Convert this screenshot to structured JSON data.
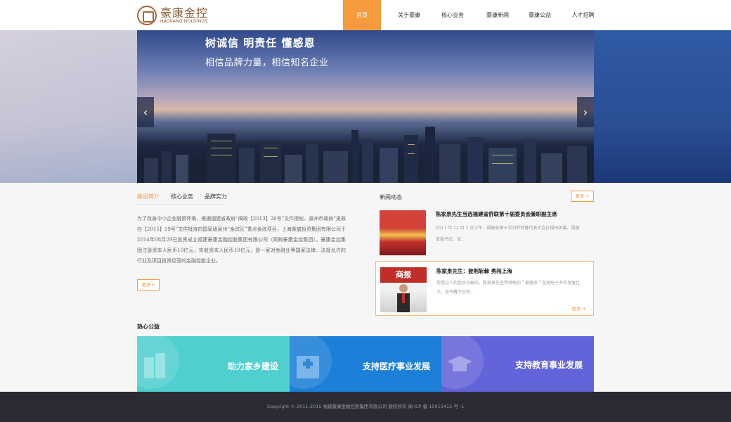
{
  "logo": {
    "cn": "豪康金控",
    "en": "HAOKANG HOLDINGS"
  },
  "nav": {
    "items": [
      {
        "label": "首页",
        "active": true
      },
      {
        "label": "关于豪康",
        "active": false
      },
      {
        "label": "核心业务",
        "active": false
      },
      {
        "label": "豪康新闻",
        "active": false
      },
      {
        "label": "豪康公益",
        "active": false
      },
      {
        "label": "人才招聘",
        "active": false
      }
    ]
  },
  "hero": {
    "title": "树诚信 明责任 懂感恩",
    "subtitle": "相信品牌力量，相信知名企业",
    "prev": "‹",
    "next": "›"
  },
  "intro": {
    "tabs": [
      "集团简介",
      "核心业务",
      "品牌实力"
    ],
    "text": "为了改善中小企业融资环境，根据福建省政府“闽政【2013】26号”文件授权、泉州市政府“泉政办【2015】19号”文件批准的国家级泉州“金改区”重点金改项目，上海豪盛投资集团有限公司于2014年08月29日投资成立福建豪康金融控股集团有限公司（简称豪康金控集团）。豪康金控集团注册资本人民币10亿元，实收资本人民币10亿元，是一家对金融业等国家法律、法规允许的行业及项目投资经营的金融控股企业。",
    "more": "更多+"
  },
  "news": {
    "title": "新闻动态",
    "more": "更多 +",
    "items": [
      {
        "headline": "陈家泉先生当选福建省侨联第十届委员会兼职副主席",
        "summary": "2017 年 12 月 7 日上午，福建省第十次归侨侨眷代表大会在福州闭幕。福建省委书记、省..."
      },
      {
        "headline": "陈家泉先生：披荆斩棘 勇闯上海",
        "summary": "凭借过人的胆识与眼光，陈家泉先生带领他的＂豪盛系＂在短短十多年发展壮大。如今耀下已有...",
        "thumb_banner": "商报",
        "more": "更多 +"
      }
    ]
  },
  "charity": {
    "title": "热心公益",
    "items": [
      {
        "label": "助力家乡建设"
      },
      {
        "label": "支持医疗事业发展"
      },
      {
        "label": "支持教育事业发展"
      }
    ]
  },
  "footer": {
    "text": "Copyright © 2011-2015 福建豪康金融控股集团有限公司 版权所有 闽 ICP 备 15015415 号 -1"
  },
  "colors": {
    "accent": "#f79a3d",
    "brand": "#8b5a30",
    "footer_bg": "#2a2b33"
  }
}
